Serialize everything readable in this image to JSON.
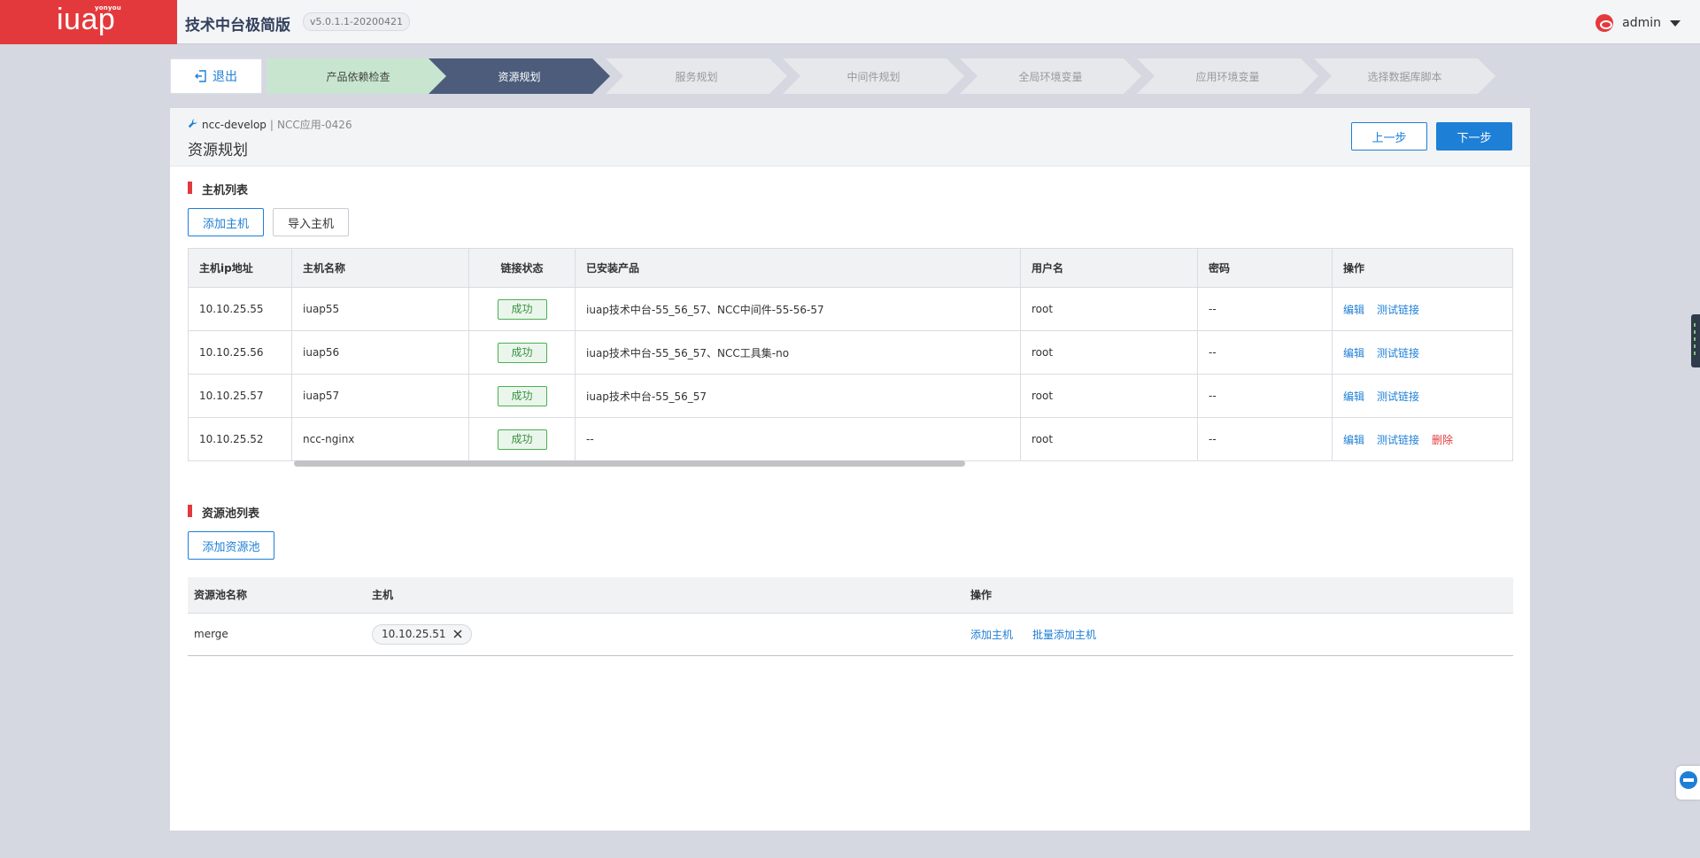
{
  "header": {
    "logo_small": "yonyou",
    "logo_main": "iuap",
    "app_title": "技术中台极简版",
    "version": "v5.0.1.1-20200421",
    "username": "admin"
  },
  "toolbar": {
    "exit_label": "退出"
  },
  "steps": [
    {
      "label": "产品依赖检查",
      "state": "done"
    },
    {
      "label": "资源规划",
      "state": "active"
    },
    {
      "label": "服务规划",
      "state": "todo"
    },
    {
      "label": "中间件规划",
      "state": "todo"
    },
    {
      "label": "全局环境变量",
      "state": "todo"
    },
    {
      "label": "应用环境变量",
      "state": "todo"
    },
    {
      "label": "选择数据库脚本",
      "state": "todo"
    }
  ],
  "breadcrumb": {
    "project": "ncc-develop",
    "separator": " | ",
    "app": "NCC应用-0426"
  },
  "page": {
    "title": "资源规划",
    "prev_label": "上一步",
    "next_label": "下一步"
  },
  "host_section": {
    "title": "主机列表",
    "add_label": "添加主机",
    "import_label": "导入主机",
    "columns": [
      "主机ip地址",
      "主机名称",
      "链接状态",
      "已安装产品",
      "用户名",
      "密码",
      "操作"
    ],
    "rows": [
      {
        "ip": "10.10.25.55",
        "name": "iuap55",
        "status": "成功",
        "products": "iuap技术中台-55_56_57、NCC中间件-55-56-57",
        "user": "root",
        "password": "--",
        "edit": "编辑",
        "test": "测试链接"
      },
      {
        "ip": "10.10.25.56",
        "name": "iuap56",
        "status": "成功",
        "products": "iuap技术中台-55_56_57、NCC工具集-no",
        "user": "root",
        "password": "--",
        "edit": "编辑",
        "test": "测试链接"
      },
      {
        "ip": "10.10.25.57",
        "name": "iuap57",
        "status": "成功",
        "products": "iuap技术中台-55_56_57",
        "user": "root",
        "password": "--",
        "edit": "编辑",
        "test": "测试链接"
      },
      {
        "ip": "10.10.25.52",
        "name": "ncc-nginx",
        "status": "成功",
        "products": "--",
        "user": "root",
        "password": "--",
        "edit": "编辑",
        "test": "测试链接",
        "delete": "删除"
      }
    ]
  },
  "pool_section": {
    "title": "资源池列表",
    "add_label": "添加资源池",
    "columns": [
      "资源池名称",
      "主机",
      "操作"
    ],
    "rows": [
      {
        "name": "merge",
        "host_chip": "10.10.25.51",
        "add_host": "添加主机",
        "batch_add_host": "批量添加主机"
      }
    ]
  },
  "icons": {
    "exit": "logout-icon",
    "breadcrumb": "wrench-icon",
    "chip_remove": "close-icon"
  },
  "colors": {
    "brand_red": "#e4393c",
    "primary_blue": "#1e7fd6",
    "step_done": "#c8e6cf",
    "step_active": "#4c5c7a",
    "success_green": "#4caf50"
  }
}
